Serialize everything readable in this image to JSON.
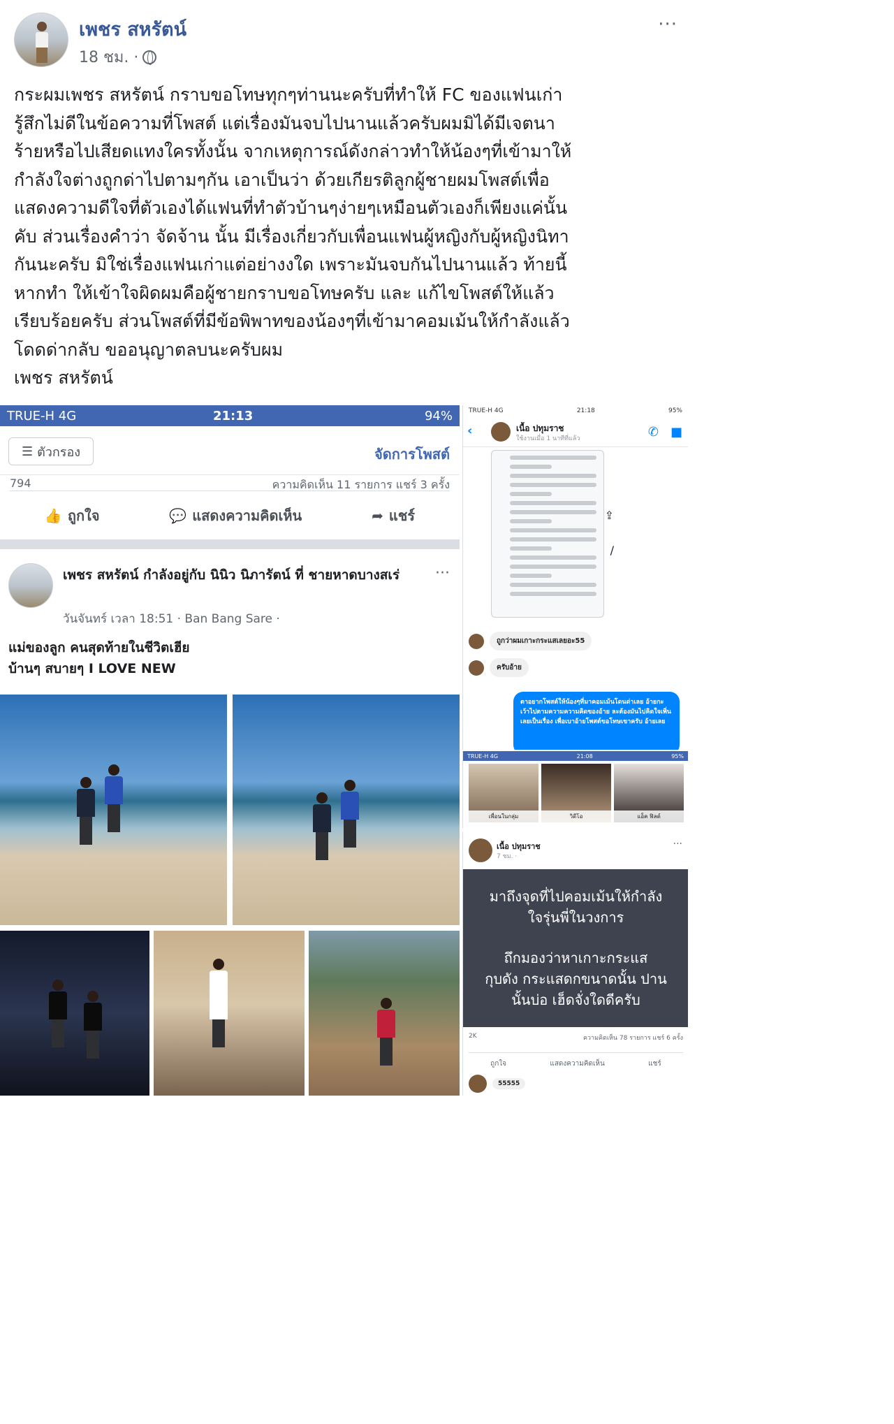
{
  "post": {
    "author": "เพชร สหรัตน์",
    "time": "18 ชม. ·",
    "more": "···",
    "text_lines": [
      "กระผมเพชร สหรัตน์ กราบขอโทษทุกๆท่านนะครับที่ทำให้ FC ของแฟนเก่า",
      "รู้สึกไม่ดีในข้อความที่โพสต์ แต่เรื่องมันจบไปนานแล้วครับผมมิได้มีเจตนา",
      "ร้ายหรือไปเสียดแทงใครทั้งนั้น จากเหตุการณ์ดังกล่าวทำให้น้องๆที่เข้ามาให้",
      "กำลังใจต่างถูกด่าไปตามๆกัน เอาเป็นว่า ด้วยเกียรติลูกผู้ชายผมโพสต์เพื่อ",
      "แสดงความดีใจที่ตัวเองได้แฟนที่ทำตัวบ้านๆง่ายๆเหมือนตัวเองก็เพียงแค่นั้น",
      "คับ ส่วนเรื่องคำว่า จัดจ้าน นั้น มีเรื่องเกี่ยวกับเพื่อนแฟนผู้หญิงกับผู้หญิงนิทา",
      "กันนะครับ มิใช่เรื่องแฟนเก่าแต่อย่างงใด เพราะมันจบกันไปนานแล้ว ท้ายนี้",
      "หากทำ ให้เข้าใจผิดผมคือผู้ชายกราบขอโทษครับ และ แก้ไขโพสต์ให้แล้ว",
      "เรียบร้อยครับ ส่วนโพสต์ที่มีข้อพิพาทของน้องๆที่เข้ามาคอมเม้นให้กำลังแล้ว",
      "โดดด่ากลับ ขออนุญาตลบนะครับผม",
      "เพชร สหรัตน์"
    ]
  },
  "left_shot": {
    "status": {
      "carrier": "TRUE-H  4G",
      "time": "21:13",
      "battery": "94%"
    },
    "filter_label": "ตัวกรอง",
    "manage_label": "จัดการโพสต์",
    "reactions_count": "794",
    "cut_text": "ความคิดเห็น 11 รายการ  แชร์ 3 ครั้ง",
    "actions": {
      "like": "ถูกใจ",
      "comment": "แสดงความคิดเห็น",
      "share": "แชร์"
    },
    "inner_post": {
      "title": "เพชร สหรัตน์ กำลังอยู่กับ นินิว นิภารัตน์ ที่ ชายหาดบางสเร่",
      "meta": "วันจันทร์ เวลา 18:51 · Ban Bang Sare ·",
      "caption_lines": [
        "แม่ของลูก คนสุดท้ายในชีวิตเฮีย",
        "บ้านๆ สบายๆ I LOVE NEW"
      ]
    }
  },
  "right_top": {
    "status": {
      "carrier": "TRUE-H  4G",
      "time": "21:18",
      "battery": "95%"
    },
    "contact_name": "เนื้อ ปทุมราช",
    "contact_sub": "ใช้งานเมื่อ 1 นาทีที่แล้ว",
    "chat_1": "ถูกว่าผมเกาะกระแสเลยอะ55",
    "chat_2": "ครับอ้าย",
    "blue_message": "ตาอยากโพสต์ให้น้องๆที่มาคอมเม้นโดนด่าเลย อ้ายกะเว้าไปตามความความคิดของอ้าย ละต้องมันไปคิดใจเพิ่นเลยเป็นเรื่อง เพื่อเบาอ้ายโพสต์ขอโทษเขาครับ อ้ายเลย"
  },
  "right_mid": {
    "status": {
      "carrier": "TRUE-H  4G",
      "time": "21:08",
      "battery": "95%"
    },
    "captions": [
      "เพื่อนในกลุ่ม",
      "วิดีโอ",
      "แอ็ค ฟิลด์"
    ]
  },
  "right_bottom": {
    "author": "เนื้อ ปทุมราช",
    "time": "7 ชม. ·",
    "card_lines_1": [
      "มาถึงจุดที่ไปคอมเม้นให้กำลัง",
      "ใจรุ่นพี่ในวงการ"
    ],
    "card_lines_2": [
      "ถึกมองว่าหาเกาะกระแส",
      "กุบดัง กระแสดกขนาดนั้น ปาน",
      "นั้นบ่อ เฮ็ดจั่งใดดีครับ"
    ],
    "reactions": "2K",
    "stats": "ความคิดเห็น 78 รายการ  แชร์ 6 ครั้ง",
    "actions": {
      "like": "ถูกใจ",
      "comment": "แสดงความคิดเห็น",
      "share": "แชร์"
    },
    "commenter": "55555"
  }
}
